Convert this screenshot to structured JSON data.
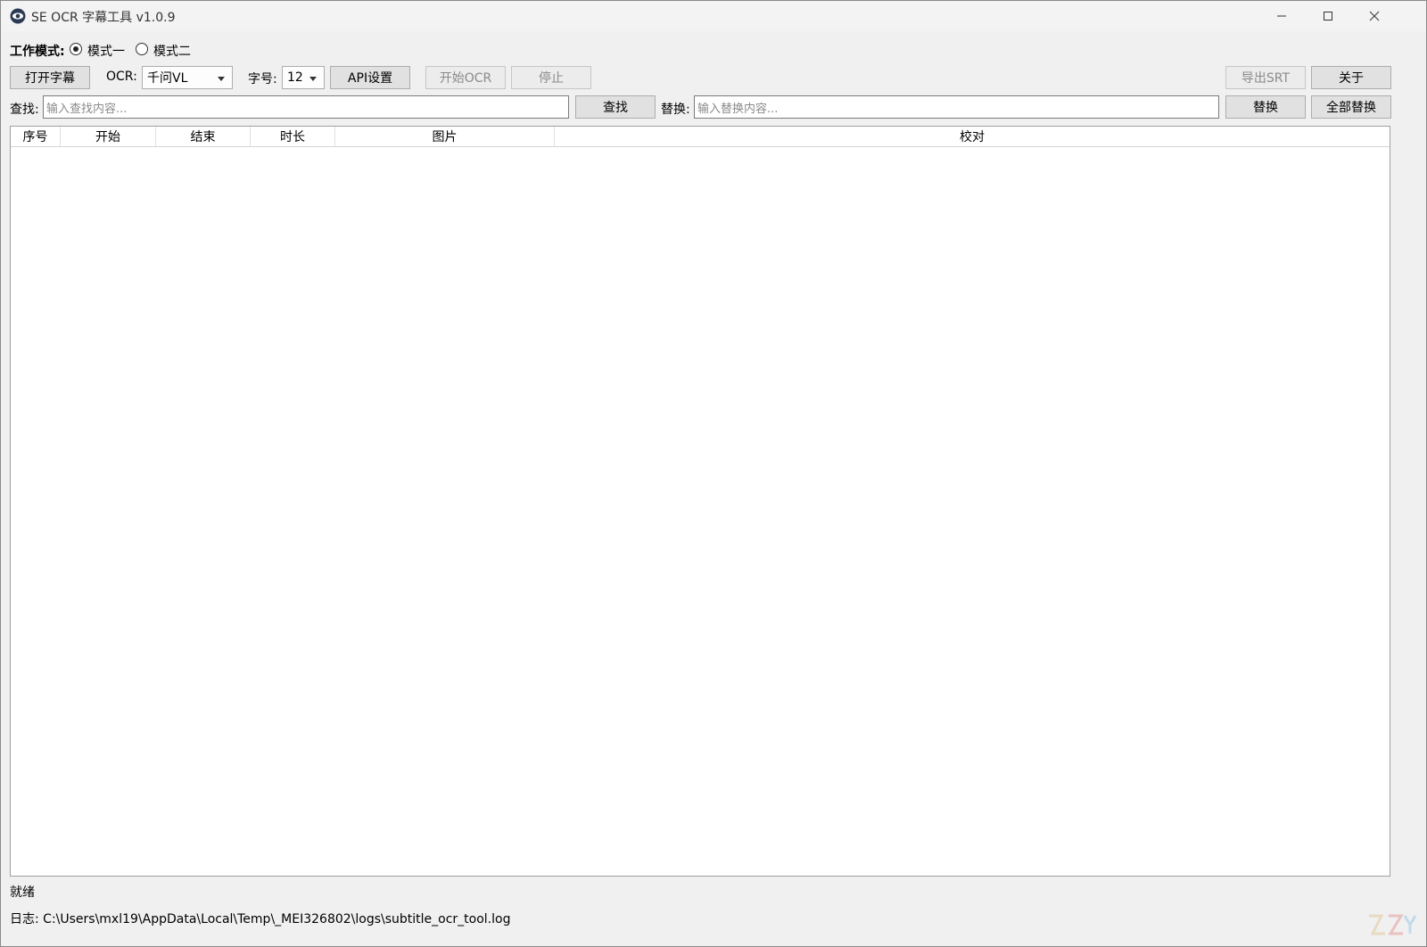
{
  "window": {
    "title": "SE OCR 字幕工具 v1.0.9",
    "icon": "eye-icon",
    "controls": [
      "minimize-icon",
      "maximize-icon",
      "close-icon"
    ]
  },
  "mode": {
    "label": "工作模式:",
    "options": [
      {
        "label": "模式一",
        "checked": true
      },
      {
        "label": "模式二",
        "checked": false
      }
    ]
  },
  "toolbar": {
    "open_subtitle": "打开字幕",
    "ocr_label": "OCR:",
    "ocr_value": "千问VL",
    "font_size_label": "字号:",
    "font_size_value": "12",
    "api_settings": "API设置",
    "start_ocr": "开始OCR",
    "stop": "停止",
    "export_srt": "导出SRT",
    "about": "关于"
  },
  "search": {
    "find_label": "查找:",
    "find_placeholder": "输入查找内容...",
    "find_button": "查找",
    "replace_label": "替换:",
    "replace_placeholder": "输入替换内容...",
    "replace_button": "替换",
    "replace_all_button": "全部替换"
  },
  "table": {
    "columns": [
      "序号",
      "开始",
      "结束",
      "时长",
      "图片",
      "校对"
    ],
    "rows": []
  },
  "status": {
    "text": "就绪",
    "log": "日志: C:\\Users\\mxl19\\AppData\\Local\\Temp\\_MEI326802\\logs\\subtitle_ocr_tool.log"
  },
  "colors": {
    "window_bg": "#f0f0f0",
    "button_bg": "#e1e1e1",
    "disabled_text": "#8a8a8a"
  }
}
